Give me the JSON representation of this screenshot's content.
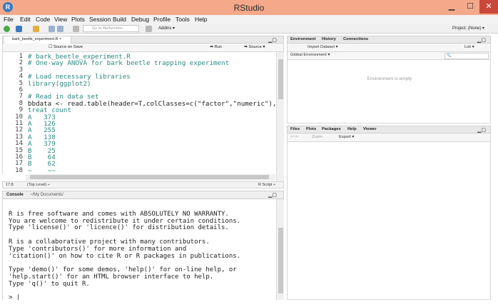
{
  "window": {
    "title": "RStudio",
    "logo": "R",
    "minimize": "▁",
    "maximize": "☐",
    "close": "✕"
  },
  "menu": [
    "File",
    "Edit",
    "Code",
    "View",
    "Plots",
    "Session",
    "Build",
    "Debug",
    "Profile",
    "Tools",
    "Help"
  ],
  "toolbar": {
    "goto_placeholder": "Go to file/function",
    "addins": "Addins ▾",
    "project": "Project: (None) ▾"
  },
  "editor": {
    "tab_label": "bark_beetle_experiment.R ×",
    "source_on_save": "Source on Save",
    "run": "Run",
    "source": "Source ▾",
    "lines": [
      {
        "n": "1",
        "text": "# bark_beetle_experiment.R",
        "cls": "c-comment"
      },
      {
        "n": "2",
        "text": "# One-way ANOVA for bark beetle trapping experiment",
        "cls": "c-comment"
      },
      {
        "n": "3",
        "text": "",
        "cls": ""
      },
      {
        "n": "4",
        "text": "# Load necessary libraries",
        "cls": "c-comment"
      },
      {
        "n": "5",
        "text": "library(ggplot2)",
        "cls": "c-fn"
      },
      {
        "n": "6",
        "text": "",
        "cls": ""
      },
      {
        "n": "7",
        "text": "# Read in data set",
        "cls": "c-comment"
      },
      {
        "n": "8",
        "text": "bbdata <- read.table(header=T,colClasses=c(\"factor\",\"numeric\"),text=",
        "cls": ""
      },
      {
        "n": "9",
        "text": "treat count",
        "cls": "c-fn"
      },
      {
        "n": "10",
        "text": "A   373",
        "cls": "c-fn"
      },
      {
        "n": "11",
        "text": "A   126",
        "cls": "c-fn"
      },
      {
        "n": "12",
        "text": "A   255",
        "cls": "c-fn"
      },
      {
        "n": "13",
        "text": "A   138",
        "cls": "c-fn"
      },
      {
        "n": "14",
        "text": "A   379",
        "cls": "c-fn"
      },
      {
        "n": "15",
        "text": "B    25",
        "cls": "c-fn"
      },
      {
        "n": "16",
        "text": "B    64",
        "cls": "c-fn"
      },
      {
        "n": "17",
        "text": "B    62",
        "cls": "c-fn"
      },
      {
        "n": "18",
        "text": "~    ~~",
        "cls": "c-fn"
      }
    ],
    "status_pos": "17:8",
    "status_scope": "(Top Level) ÷",
    "status_type": "R Script ÷"
  },
  "console": {
    "title": "Console",
    "path": "~/My Documents/",
    "lines": [
      "",
      "R is free software and comes with ABSOLUTELY NO WARRANTY.",
      "You are welcome to redistribute it under certain conditions.",
      "Type 'license()' or 'licence()' for distribution details.",
      "",
      "R is a collaborative project with many contributors.",
      "Type 'contributors()' for more information and",
      "'citation()' on how to cite R or R packages in publications.",
      "",
      "Type 'demo()' for some demos, 'help()' for on-line help, or",
      "'help.start()' for an HTML browser interface to help.",
      "Type 'q()' to quit R.",
      "",
      "> |"
    ]
  },
  "env_pane": {
    "tabs": [
      "Environment",
      "History",
      "Connections"
    ],
    "import": "Import Dataset ▾",
    "list": "List ▾",
    "global_env": "Global Environment ▾",
    "empty_msg": "Environment is empty",
    "search_icon": "🔍"
  },
  "files_pane": {
    "tabs": [
      "Files",
      "Plots",
      "Packages",
      "Help",
      "Viewer"
    ],
    "zoom": "Zoom",
    "export": "Export ▾"
  },
  "colors": {
    "titlebar": "#f4a98a",
    "close": "#c9483b",
    "code_green": "#2d8a82"
  }
}
